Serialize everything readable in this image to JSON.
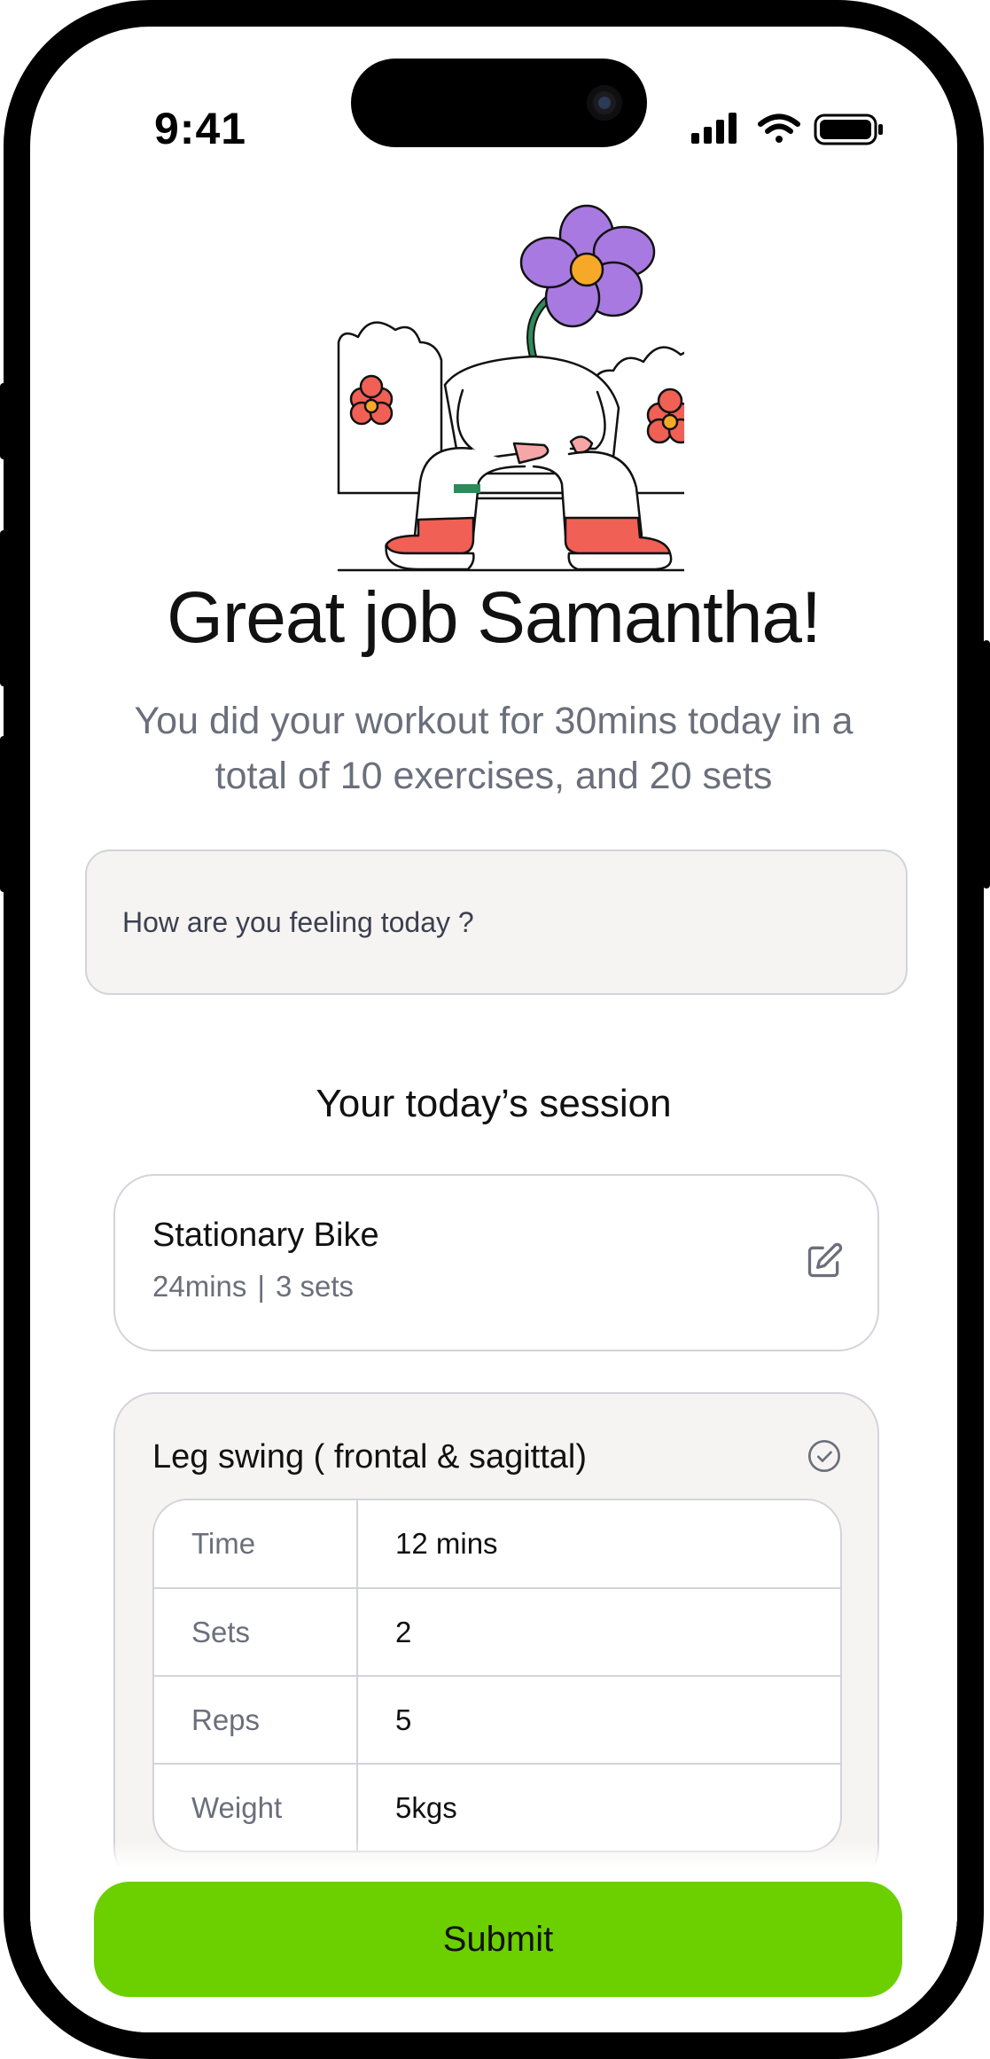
{
  "status_bar": {
    "time": "9:41"
  },
  "hero": {
    "title": "Great job Samantha!",
    "subtitle": "You did your workout for 30mins today in a total of 10 exercises, and 20 sets"
  },
  "feeling_input": {
    "placeholder": "How are you feeling today ?"
  },
  "session": {
    "heading": "Your today’s session",
    "items": [
      {
        "name": "Stationary Bike",
        "duration": "24mins",
        "separator": "|",
        "sets": "3 sets",
        "action_icon": "edit-icon"
      },
      {
        "name": "Leg swing ( frontal & sagittal)",
        "status_icon": "check-circle-icon",
        "details": [
          {
            "key": "Time",
            "value": "12 mins"
          },
          {
            "key": "Sets",
            "value": "2"
          },
          {
            "key": "Reps",
            "value": "5"
          },
          {
            "key": "Weight",
            "value": "5kgs"
          }
        ]
      }
    ]
  },
  "submit_label": "Submit",
  "colors": {
    "accent_green": "#6ccf00",
    "flower_purple": "#a879e0",
    "flower_center": "#f6a928",
    "shoe_red": "#f06055",
    "muted_text": "#6b6f7b"
  }
}
